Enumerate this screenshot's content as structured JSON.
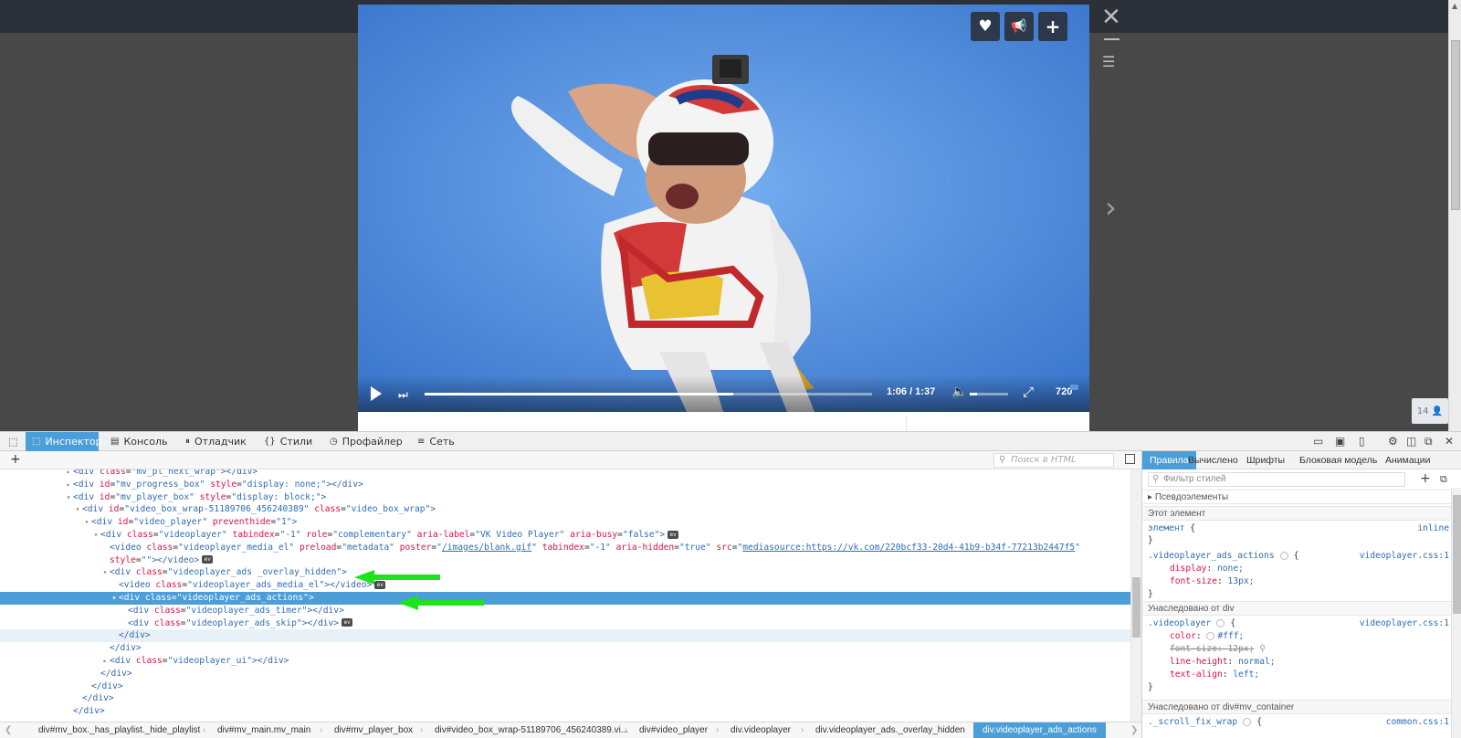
{
  "page": {
    "badge_count": "14",
    "badge_icon": "user-icon"
  },
  "video": {
    "actions": [
      "heart-icon",
      "megaphone-icon",
      "plus-icon"
    ],
    "time": "1:06 / 1:37",
    "quality": "720",
    "progress": 0.69,
    "volume": 0.2
  },
  "devtools": {
    "tabs": [
      {
        "label": "Инспектор",
        "icon": "inspector-icon",
        "active": true
      },
      {
        "label": "Консоль",
        "icon": "console-icon"
      },
      {
        "label": "Отладчик",
        "icon": "debugger-icon"
      },
      {
        "label": "Стили",
        "icon": "braces-icon"
      },
      {
        "label": "Профайлер",
        "icon": "profiler-icon"
      },
      {
        "label": "Сеть",
        "icon": "network-icon"
      }
    ],
    "html_search_placeholder": "Поиск в HTML",
    "markup": [
      {
        "indent": 0,
        "twisty": "▸",
        "html": "<span class=\"tag\">&lt;div</span> <span class=\"an\">class</span>=<span class=\"av\">\"mv_pl_next_wrap\"</span><span class=\"tag\">&gt;&lt;/div&gt;</span>"
      },
      {
        "indent": 0,
        "twisty": "▸",
        "html": "<span class=\"tag\">&lt;div</span> <span class=\"an\">id</span>=<span class=\"av\">\"mv_progress_box\"</span> <span class=\"an\">style</span>=<span class=\"av\">\"display: none;\"</span><span class=\"tag\">&gt;&lt;/div&gt;</span>"
      },
      {
        "indent": 0,
        "twisty": "▾",
        "html": "<span class=\"tag\">&lt;div</span> <span class=\"an\">id</span>=<span class=\"av\">\"mv_player_box\"</span> <span class=\"an\">style</span>=<span class=\"av\">\"display: block;\"</span><span class=\"tag\">&gt;</span>"
      },
      {
        "indent": 1,
        "twisty": "▾",
        "html": "<span class=\"tag\">&lt;div</span> <span class=\"an\">id</span>=<span class=\"av\">\"video_box_wrap-51189706_456240389\"</span> <span class=\"an\">class</span>=<span class=\"av\">\"video_box_wrap\"</span><span class=\"tag\">&gt;</span>"
      },
      {
        "indent": 2,
        "twisty": "▾",
        "html": "<span class=\"tag\">&lt;div</span> <span class=\"an\">id</span>=<span class=\"av\">\"video_player\"</span> <span class=\"an\">preventhide</span>=<span class=\"av\">\"1\"</span><span class=\"tag\">&gt;</span>"
      },
      {
        "indent": 3,
        "twisty": "▾",
        "html": "<span class=\"tag\">&lt;div</span> <span class=\"an\">class</span>=<span class=\"av\">\"videoplayer\"</span> <span class=\"an\">tabindex</span>=<span class=\"av\">\"-1\"</span> <span class=\"an\">role</span>=<span class=\"av\">\"complementary\"</span> <span class=\"an\">aria-label</span>=<span class=\"av\">\"VK Video Player\"</span> <span class=\"an\">aria-busy</span>=<span class=\"av\">\"false\"</span><span class=\"tag\">&gt;</span><span class=\"ev\">ev</span>"
      },
      {
        "indent": 4,
        "twisty": "",
        "html": "<span class=\"tag\">&lt;video</span> <span class=\"an\">class</span>=<span class=\"av\">\"videoplayer_media_el\"</span> <span class=\"an\">preload</span>=<span class=\"av\">\"metadata\"</span> <span class=\"an\">poster</span>=<span class=\"av\">\"<span class=\"link\">/images/blank.gif</span>\"</span> <span class=\"an\">tabindex</span>=<span class=\"av\">\"-1\"</span> <span class=\"an\">aria-hidden</span>=<span class=\"av\">\"true\"</span> <span class=\"an\">src</span>=<span class=\"av\">\"<span class=\"link\">mediasource:https://vk.com/220bcf33-20d4-41b9-b34f-77213b2447f5</span>\"</span>"
      },
      {
        "indent": 4,
        "twisty": "",
        "html": "<span class=\"an\">style</span>=<span class=\"av\">\"\"</span><span class=\"tag\">&gt;&lt;/video&gt;</span><span class=\"ev\">ev</span>"
      },
      {
        "indent": 4,
        "twisty": "▾",
        "html": "<span class=\"tag\">&lt;div</span> <span class=\"an\">class</span>=<span class=\"av\">\"videoplayer_ads _overlay_hidden\"</span><span class=\"tag\">&gt;</span>"
      },
      {
        "indent": 5,
        "twisty": "",
        "html": "<span class=\"tag\">&lt;video</span> <span class=\"an\">class</span>=<span class=\"av\">\"videoplayer_ads_media_el\"</span><span class=\"tag\">&gt;&lt;/video&gt;</span><span class=\"ev\">ev</span>"
      },
      {
        "indent": 5,
        "twisty": "▾",
        "sel": true,
        "html": "<span class=\"tag\">&lt;div</span> <span class=\"an\">class</span>=<span class=\"av\">\"videoplayer_ads_actions\"</span><span class=\"tag\">&gt;</span>"
      },
      {
        "indent": 6,
        "twisty": "",
        "html": "<span class=\"tag\">&lt;div</span> <span class=\"an\">class</span>=<span class=\"av\">\"videoplayer_ads_timer\"</span><span class=\"tag\">&gt;&lt;/div&gt;</span>"
      },
      {
        "indent": 6,
        "twisty": "",
        "html": "<span class=\"tag\">&lt;div</span> <span class=\"an\">class</span>=<span class=\"av\">\"videoplayer_ads_skip\"</span><span class=\"tag\">&gt;&lt;/div&gt;</span><span class=\"ev\">ev</span>"
      },
      {
        "indent": 5,
        "twisty": "",
        "hover": true,
        "html": "<span class=\"tag\">&lt;/div&gt;</span>"
      },
      {
        "indent": 4,
        "twisty": "",
        "html": "<span class=\"tag\">&lt;/div&gt;</span>"
      },
      {
        "indent": 4,
        "twisty": "▸",
        "html": "<span class=\"tag\">&lt;div</span> <span class=\"an\">class</span>=<span class=\"av\">\"videoplayer_ui\"</span><span class=\"tag\">&gt;&lt;/div&gt;</span>"
      },
      {
        "indent": 3,
        "twisty": "",
        "html": "<span class=\"tag\">&lt;/div&gt;</span>"
      },
      {
        "indent": 2,
        "twisty": "",
        "html": "<span class=\"tag\">&lt;/div&gt;</span>"
      },
      {
        "indent": 1,
        "twisty": "",
        "html": "<span class=\"tag\">&lt;/div&gt;</span>"
      },
      {
        "indent": 0,
        "twisty": "",
        "html": "<span class=\"tag\">&lt;/div&gt;</span>"
      }
    ],
    "breadcrumbs": [
      "div#mv_box._has_playlist._hide_playlist",
      "div#mv_main.mv_main",
      "div#mv_player_box",
      "div#video_box_wrap-51189706_456240389.vi...",
      "div#video_player",
      "div.videoplayer",
      "div.videoplayer_ads._overlay_hidden",
      "div.videoplayer_ads_actions"
    ],
    "rules_tabs": [
      "Правила",
      "Вычислено",
      "Шрифты",
      "Блоковая модель",
      "Анимации"
    ],
    "filter_placeholder": "Фильтр стилей",
    "pseudo_label": "Псевдоэлементы",
    "this_element": "Этот элемент",
    "element_selector": "элемент",
    "element_source": "inline",
    "rule1": {
      "selector": ".videoplayer_ads_actions",
      "source": "videoplayer.css:1",
      "props": [
        [
          "display",
          "none;"
        ],
        [
          "font-size",
          "13px;"
        ]
      ]
    },
    "inherited1": "Унаследовано от div",
    "rule2": {
      "selector": ".videoplayer",
      "source": "videoplayer.css:1",
      "color_prop": "color",
      "color_val": "#fff;",
      "struck": "font-size: 12px;",
      "props": [
        [
          "line-height",
          "normal;"
        ],
        [
          "text-align",
          "left;"
        ]
      ]
    },
    "inherited2": "Унаследовано от div#mv_container",
    "rule3": {
      "selector": "._scroll_fix_wrap",
      "source": "common.css:1"
    }
  }
}
